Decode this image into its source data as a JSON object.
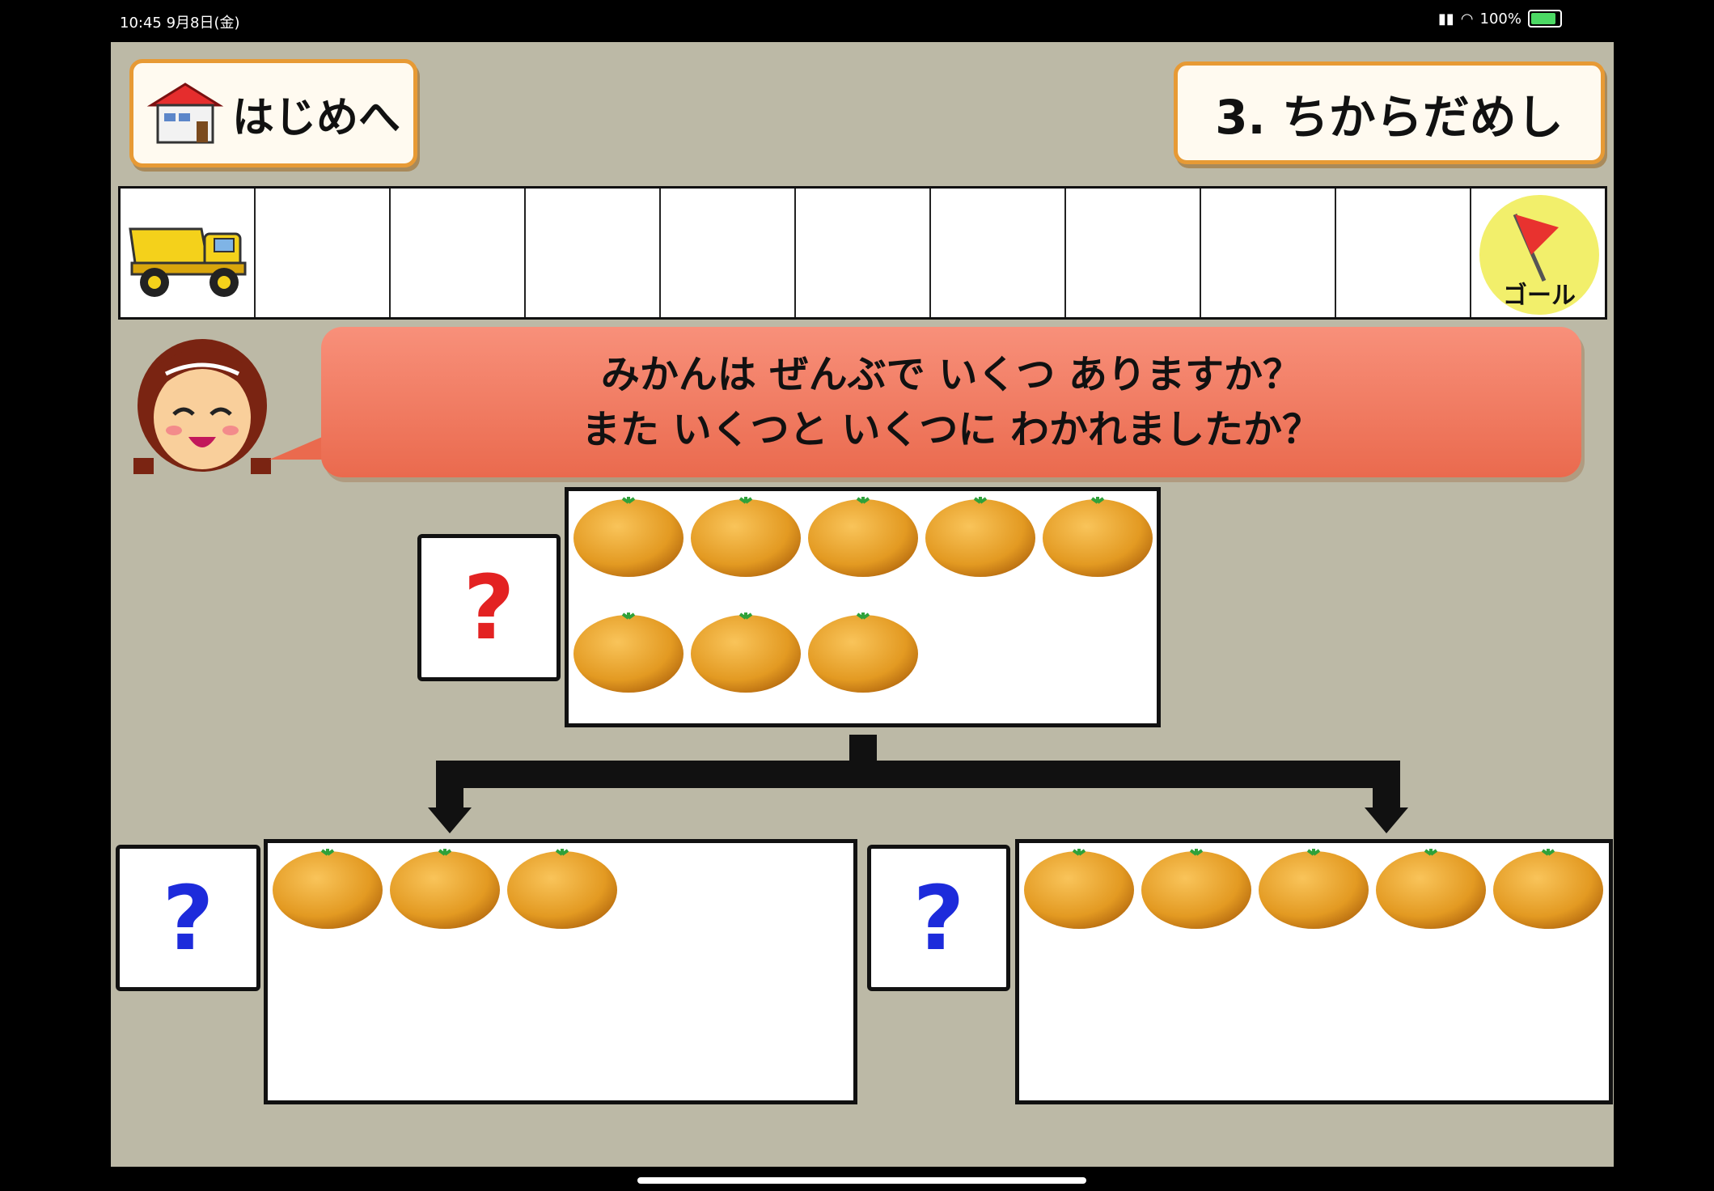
{
  "status_bar": {
    "time": "10:45 9月8日(金)",
    "battery": "100%"
  },
  "header": {
    "home_button_label": "はじめへ",
    "section_title": "3. ちからだめし"
  },
  "progress_track": {
    "total_cells": 11,
    "current_cell": 1,
    "goal_label": "ゴール"
  },
  "question": {
    "line1": "みかんは ぜんぶで いくつ ありますか？",
    "line2": "また いくつと いくつに わかれましたか？"
  },
  "total_group": {
    "answer_placeholder": "?",
    "orange_count": 8
  },
  "left_group": {
    "answer_placeholder": "?",
    "orange_count": 3
  },
  "right_group": {
    "answer_placeholder": "?",
    "orange_count": 5
  },
  "colors": {
    "background": "#bcb9a6",
    "button_border": "#e79a35",
    "speech_bubble": "#ea6a4e",
    "total_question_mark": "#e32222",
    "part_question_mark": "#1d2bdb",
    "orange": "#e7a128"
  },
  "icons": [
    "house-icon",
    "dump-truck-icon",
    "goal-flag-icon",
    "girl-avatar",
    "mikan-orange-icon",
    "down-arrow-icon"
  ]
}
